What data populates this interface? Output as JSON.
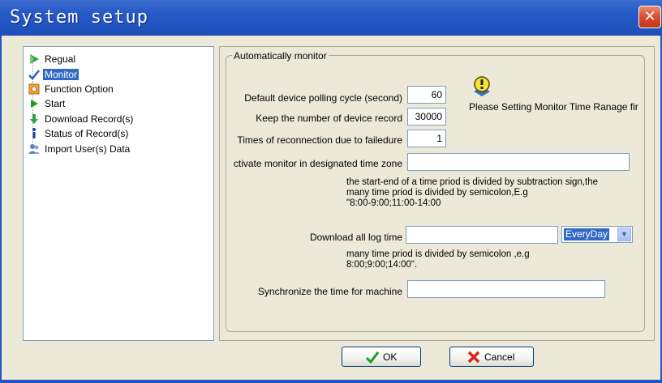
{
  "window": {
    "title": "System setup",
    "close_glyph": "✕"
  },
  "tree": {
    "items": [
      {
        "label": "Regual",
        "icon": "green-play-arrow-icon"
      },
      {
        "label": "Monitor",
        "icon": "checkmark-icon",
        "selected": true
      },
      {
        "label": "Function Option",
        "icon": "gear-box-icon"
      },
      {
        "label": "Start",
        "icon": "play-icon"
      },
      {
        "label": "Download Record(s)",
        "icon": "download-arrow-icon"
      },
      {
        "label": "Status of Record(s)",
        "icon": "info-icon"
      },
      {
        "label": "Import User(s) Data",
        "icon": "users-icon"
      }
    ]
  },
  "group": {
    "title": "Automatically monitor"
  },
  "form": {
    "polling_label": "Default device polling cycle (second)",
    "polling_value": "60",
    "record_label": "Keep the number of device record",
    "record_value": "30000",
    "reconnect_label": "Times of reconnection due to failedure",
    "reconnect_value": "1",
    "activate_label": "ctivate monitor in designated time zone",
    "activate_value": "",
    "activate_note_1": "the start-end of a time priod is divided  by subtraction sign,the",
    "activate_note_2": "many time priod is divided by semicolon,E.g",
    "activate_note_3": "\"8:00-9:00;11:00-14:00",
    "warning_text": "Please Setting Monitor Time Ranage fir",
    "download_label": "Download all log time",
    "download_value": "",
    "download_select": "EveryDay",
    "download_note_1": "many time priod is divided by semicolon ,e.g",
    "download_note_2": "8:00;9:00;14:00\".",
    "sync_label": "Synchronize the time for machine",
    "sync_value": ""
  },
  "buttons": {
    "ok": "OK",
    "cancel": "Cancel"
  },
  "colors": {
    "titlebar": "#2356c4",
    "selection": "#316ac5",
    "face": "#ece9d8"
  }
}
